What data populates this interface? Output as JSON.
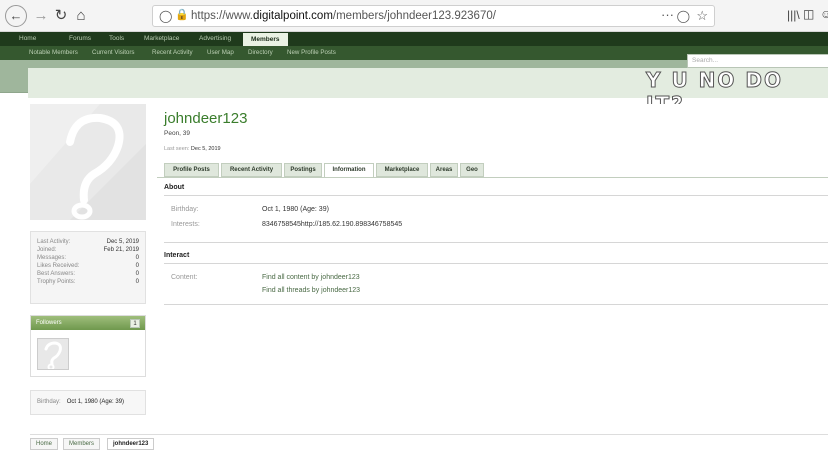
{
  "browser": {
    "back_icon": "back-arrow-icon",
    "url_scheme": "https://www.",
    "url_domain": "digitalpoint.com",
    "url_path": "/members/johndeer123.923670/",
    "more_glyph": "···"
  },
  "topnav": {
    "tabs": [
      {
        "label": "Home"
      },
      {
        "label": "Forums"
      },
      {
        "label": "Tools"
      },
      {
        "label": "Marketplace"
      },
      {
        "label": "Advertising"
      },
      {
        "label": "Members"
      }
    ]
  },
  "subnav": {
    "items": [
      {
        "label": "Notable Members"
      },
      {
        "label": "Current Visitors"
      },
      {
        "label": "Recent Activity"
      },
      {
        "label": "User Map"
      },
      {
        "label": "Directory"
      },
      {
        "label": "New Profile Posts"
      }
    ]
  },
  "search": {
    "placeholder": "Search..."
  },
  "banner": {
    "meme_text": "Y U NO DO IT?"
  },
  "profile": {
    "username": "johndeer123",
    "title": "Peon, 39",
    "last_seen_label": "Last seen:",
    "last_seen_value": "Dec 5, 2019"
  },
  "stats": [
    {
      "label": "Last Activity:",
      "value": "Dec 5, 2019"
    },
    {
      "label": "Joined:",
      "value": "Feb 21, 2019"
    },
    {
      "label": "Messages:",
      "value": "0"
    },
    {
      "label": "Likes Received:",
      "value": "0"
    },
    {
      "label": "Best Answers:",
      "value": "0"
    },
    {
      "label": "Trophy Points:",
      "value": "0"
    }
  ],
  "followers": {
    "label": "Followers",
    "count": "1"
  },
  "birthday_box": {
    "label": "Birthday:",
    "value": "Oct 1, 1980 (Age: 39)"
  },
  "tabs": [
    {
      "label": "Profile Posts"
    },
    {
      "label": "Recent Activity"
    },
    {
      "label": "Postings"
    },
    {
      "label": "Information"
    },
    {
      "label": "Marketplace"
    },
    {
      "label": "Areas"
    },
    {
      "label": "Geo"
    }
  ],
  "about": {
    "heading": "About",
    "birthday_label": "Birthday:",
    "birthday_value": "Oct 1, 1980 (Age: 39)",
    "interests_label": "Interests:",
    "interests_value": "8346758545http://185.62.190.898346758545"
  },
  "interact": {
    "heading": "Interact",
    "content_label": "Content:",
    "link1": "Find all content by johndeer123",
    "link2": "Find all threads by johndeer123"
  },
  "breadcrumb": [
    {
      "label": "Home"
    },
    {
      "label": "Members"
    },
    {
      "label": "johndeer123"
    }
  ]
}
